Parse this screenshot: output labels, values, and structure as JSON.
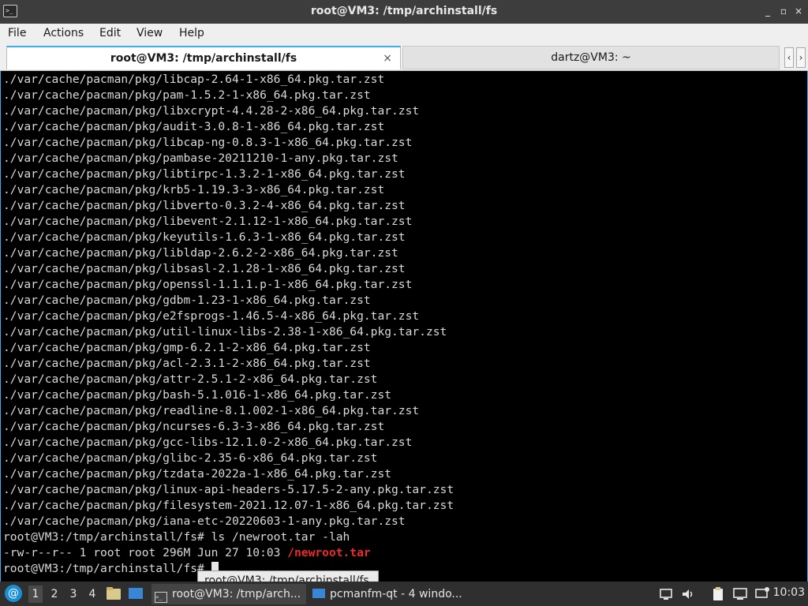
{
  "window": {
    "title": "root@VM3: /tmp/archinstall/fs",
    "app_icon_glyph": ">_",
    "controls": {
      "minimize": "_",
      "maximize": "▫",
      "close": "×"
    }
  },
  "menu": [
    "File",
    "Actions",
    "Edit",
    "View",
    "Help"
  ],
  "tabs": [
    {
      "label": "root@VM3: /tmp/archinstall/fs",
      "active": true,
      "close": "×"
    },
    {
      "label": "dartz@VM3: ~",
      "active": false
    }
  ],
  "tab_scroll": {
    "left": "‹",
    "right": "›"
  },
  "terminal": {
    "lines": [
      "./var/cache/pacman/pkg/libcap-2.64-1-x86_64.pkg.tar.zst",
      "./var/cache/pacman/pkg/pam-1.5.2-1-x86_64.pkg.tar.zst",
      "./var/cache/pacman/pkg/libxcrypt-4.4.28-2-x86_64.pkg.tar.zst",
      "./var/cache/pacman/pkg/audit-3.0.8-1-x86_64.pkg.tar.zst",
      "./var/cache/pacman/pkg/libcap-ng-0.8.3-1-x86_64.pkg.tar.zst",
      "./var/cache/pacman/pkg/pambase-20211210-1-any.pkg.tar.zst",
      "./var/cache/pacman/pkg/libtirpc-1.3.2-1-x86_64.pkg.tar.zst",
      "./var/cache/pacman/pkg/krb5-1.19.3-3-x86_64.pkg.tar.zst",
      "./var/cache/pacman/pkg/libverto-0.3.2-4-x86_64.pkg.tar.zst",
      "./var/cache/pacman/pkg/libevent-2.1.12-1-x86_64.pkg.tar.zst",
      "./var/cache/pacman/pkg/keyutils-1.6.3-1-x86_64.pkg.tar.zst",
      "./var/cache/pacman/pkg/libldap-2.6.2-2-x86_64.pkg.tar.zst",
      "./var/cache/pacman/pkg/libsasl-2.1.28-1-x86_64.pkg.tar.zst",
      "./var/cache/pacman/pkg/openssl-1.1.1.p-1-x86_64.pkg.tar.zst",
      "./var/cache/pacman/pkg/gdbm-1.23-1-x86_64.pkg.tar.zst",
      "./var/cache/pacman/pkg/e2fsprogs-1.46.5-4-x86_64.pkg.tar.zst",
      "./var/cache/pacman/pkg/util-linux-libs-2.38-1-x86_64.pkg.tar.zst",
      "./var/cache/pacman/pkg/gmp-6.2.1-2-x86_64.pkg.tar.zst",
      "./var/cache/pacman/pkg/acl-2.3.1-2-x86_64.pkg.tar.zst",
      "./var/cache/pacman/pkg/attr-2.5.1-2-x86_64.pkg.tar.zst",
      "./var/cache/pacman/pkg/bash-5.1.016-1-x86_64.pkg.tar.zst",
      "./var/cache/pacman/pkg/readline-8.1.002-1-x86_64.pkg.tar.zst",
      "./var/cache/pacman/pkg/ncurses-6.3-3-x86_64.pkg.tar.zst",
      "./var/cache/pacman/pkg/gcc-libs-12.1.0-2-x86_64.pkg.tar.zst",
      "./var/cache/pacman/pkg/glibc-2.35-6-x86_64.pkg.tar.zst",
      "./var/cache/pacman/pkg/tzdata-2022a-1-x86_64.pkg.tar.zst",
      "./var/cache/pacman/pkg/linux-api-headers-5.17.5-2-any.pkg.tar.zst",
      "./var/cache/pacman/pkg/filesystem-2021.12.07-1-x86_64.pkg.tar.zst",
      "./var/cache/pacman/pkg/iana-etc-20220603-1-any.pkg.tar.zst",
      "root@VM3:/tmp/archinstall/fs# ls /newroot.tar -lah"
    ],
    "ls_output": {
      "prefix": "-rw-r--r-- 1 root root 296M Jun 27 10:03 ",
      "filename": "/newroot.tar"
    },
    "prompt": "root@VM3:/tmp/archinstall/fs# "
  },
  "tooltip": "root@VM3: /tmp/archinstall/fs",
  "taskbar": {
    "start_icon": "debian-swirl-icon",
    "workspaces": [
      "1",
      "2",
      "3",
      "4"
    ],
    "active_workspace": "1",
    "tasks": [
      {
        "label": "root@VM3: /tmp/arch...",
        "active": true
      },
      {
        "label": "pcmanfm-qt - 4 windo...",
        "active": false
      }
    ],
    "tray_icons": [
      "network-icon",
      "volume-icon",
      "clipboard-icon",
      "display-icon",
      "notification-icon"
    ],
    "clock": "10:03",
    "colors": {
      "accent": "#3daee9",
      "highlight": "#ef2929"
    }
  }
}
